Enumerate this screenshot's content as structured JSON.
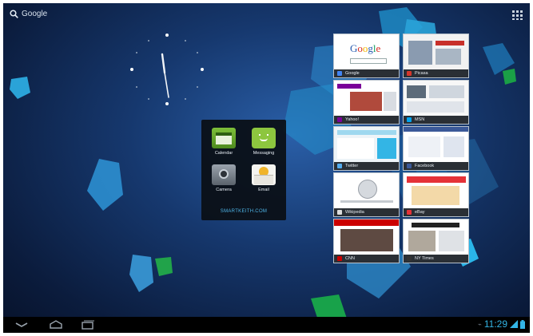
{
  "top": {
    "search_label": "Google"
  },
  "folder": {
    "items": [
      {
        "label": "Calendar"
      },
      {
        "label": "Messaging"
      },
      {
        "label": "Camera"
      },
      {
        "label": "Email"
      }
    ],
    "watermark": "SMARTKEITH.COM"
  },
  "thumbnails": [
    {
      "caption": "Google"
    },
    {
      "caption": "Picasa"
    },
    {
      "caption": "Yahoo!"
    },
    {
      "caption": "MSN"
    },
    {
      "caption": "Twitter"
    },
    {
      "caption": "Facebook"
    },
    {
      "caption": "Wikipedia"
    },
    {
      "caption": "eBay"
    },
    {
      "caption": "CNN"
    },
    {
      "caption": "NY Times"
    }
  ],
  "status": {
    "time": "11:29"
  },
  "colors": {
    "accent": "#33b5e5",
    "wallpaper": "#16386e",
    "messaging_green": "#8dc63f"
  }
}
